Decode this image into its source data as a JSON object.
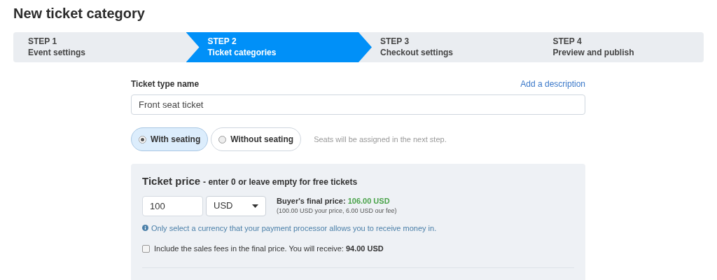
{
  "title": "New ticket category",
  "steps": [
    {
      "number": "STEP 1",
      "label": "Event settings",
      "selected": false
    },
    {
      "number": "STEP 2",
      "label": "Ticket categories",
      "selected": true
    },
    {
      "number": "STEP 3",
      "label": "Checkout settings",
      "selected": false
    },
    {
      "number": "STEP 4",
      "label": "Preview and publish",
      "selected": false
    }
  ],
  "name_field": {
    "label": "Ticket type name",
    "link": "Add a description",
    "value": "Front seat ticket"
  },
  "seating": {
    "options": [
      {
        "label": "With seating",
        "selected": true
      },
      {
        "label": "Without seating",
        "selected": false
      }
    ],
    "hint": "Seats will be assigned in the next step."
  },
  "price": {
    "title": "Ticket price",
    "subtitle": "- enter 0 or leave empty for free tickets",
    "amount": "100",
    "currency": "USD",
    "final_price_label": "Buyer's final price:",
    "final_price_value": "106.00 USD",
    "breakdown": "(100.00 USD your price, 6.00 USD our fee)",
    "info": "Only select a currency that your payment processor allows you to receive money in.",
    "include_fees": {
      "checked": false,
      "text": "Include the sales fees in the final price. You will receive: **94.00 USD**"
    }
  }
}
